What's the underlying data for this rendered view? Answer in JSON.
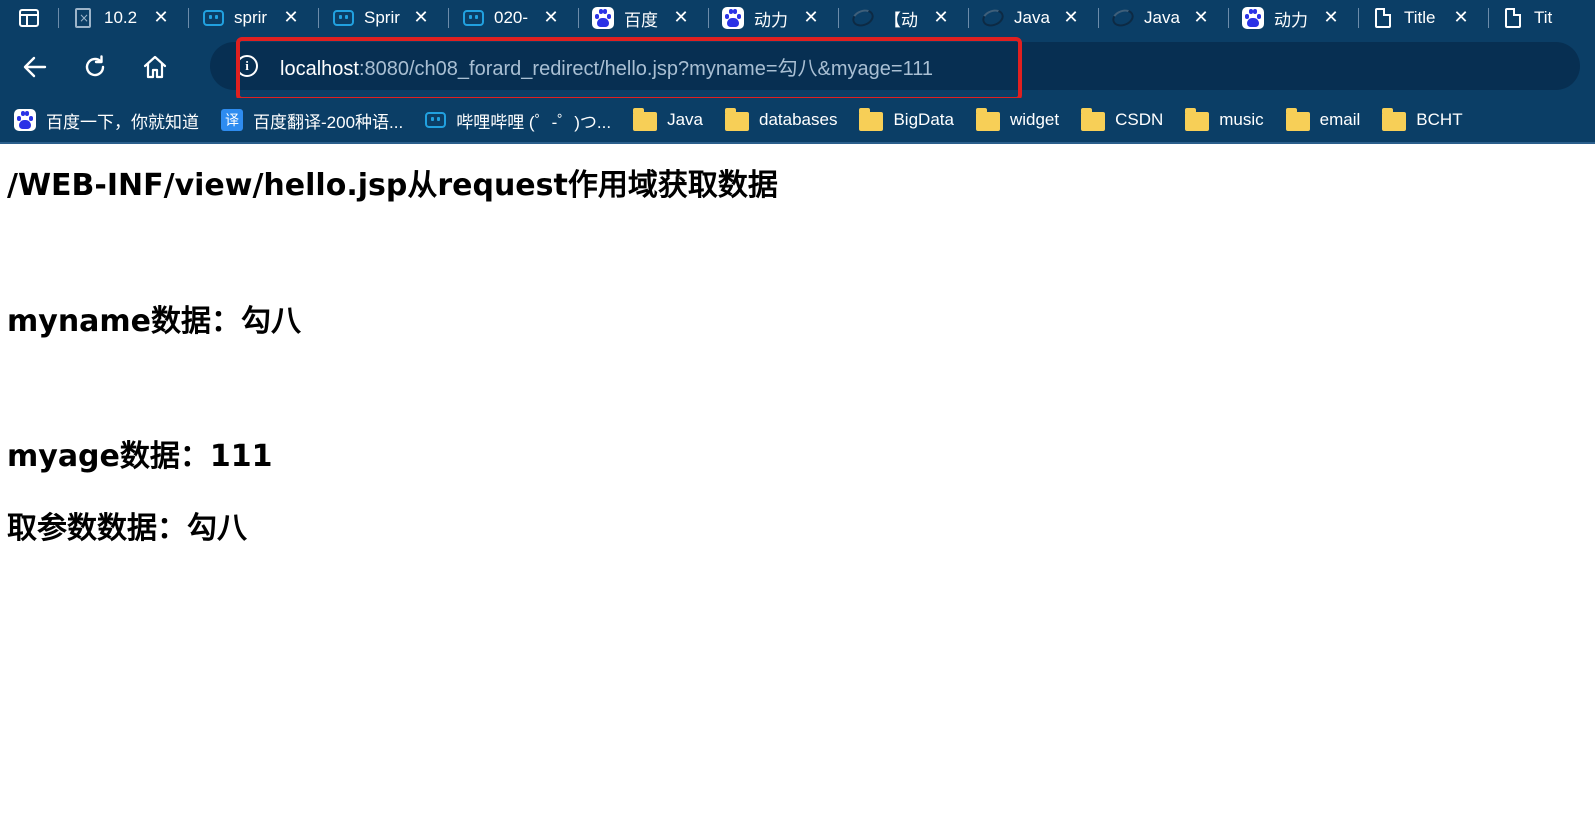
{
  "browser": {
    "tabs": [
      {
        "title": "10.2",
        "favicon": "error-page-icon"
      },
      {
        "title": "sprir",
        "favicon": "bilibili-icon"
      },
      {
        "title": "Sprir",
        "favicon": "bilibili-icon"
      },
      {
        "title": "020-",
        "favicon": "bilibili-icon"
      },
      {
        "title": "百度",
        "favicon": "baidu-icon"
      },
      {
        "title": "动力",
        "favicon": "baidu-icon"
      },
      {
        "title": "【动",
        "favicon": "swirl-icon"
      },
      {
        "title": "Java",
        "favicon": "swirl-icon"
      },
      {
        "title": "Java",
        "favicon": "swirl-icon"
      },
      {
        "title": "动力",
        "favicon": "baidu-icon"
      },
      {
        "title": "Title",
        "favicon": "page-icon"
      },
      {
        "title": "Tit",
        "favicon": "page-icon"
      }
    ],
    "address": {
      "host": "localhost",
      "rest": ":8080/ch08_forard_redirect/hello.jsp?myname=勾八&myage=111"
    },
    "bookmarks": [
      {
        "label": "百度一下，你就知道",
        "icon": "baidu-icon"
      },
      {
        "label": "百度翻译-200种语...",
        "icon": "translate-icon"
      },
      {
        "label": "哔哩哔哩 (゜-゜)つ...",
        "icon": "bilibili-icon"
      },
      {
        "label": "Java",
        "icon": "folder-icon"
      },
      {
        "label": "databases",
        "icon": "folder-icon"
      },
      {
        "label": "BigData",
        "icon": "folder-icon"
      },
      {
        "label": "widget",
        "icon": "folder-icon"
      },
      {
        "label": "CSDN",
        "icon": "folder-icon"
      },
      {
        "label": "music",
        "icon": "folder-icon"
      },
      {
        "label": "email",
        "icon": "folder-icon"
      },
      {
        "label": "BCHT",
        "icon": "folder-icon"
      }
    ],
    "colors": {
      "chrome": "#0b3e66",
      "address_field": "#072f52",
      "highlight": "#e02020"
    }
  },
  "page": {
    "line1": "/WEB-INF/view/hello.jsp从request作用域获取数据",
    "line2": "myname数据：勾八",
    "line3": "myage数据：111",
    "line4": "取参数数据：勾八"
  }
}
